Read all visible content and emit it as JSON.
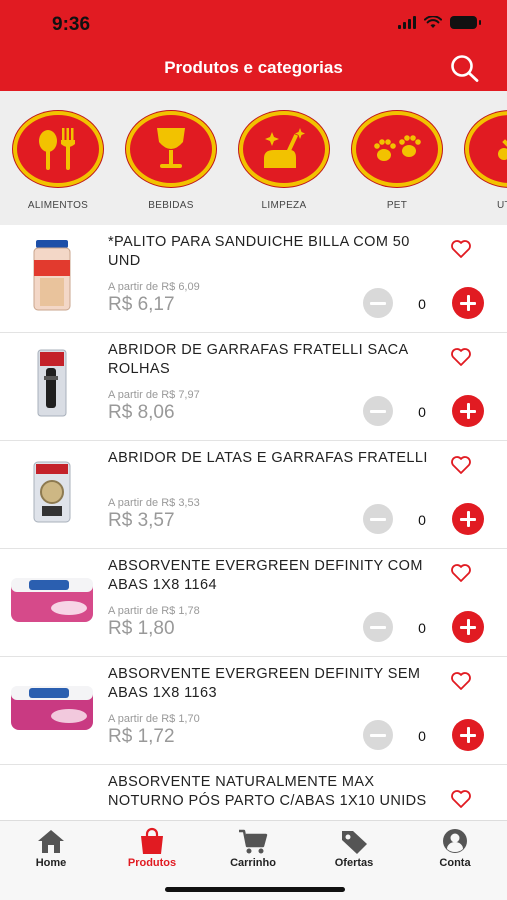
{
  "status_bar": {
    "time": "9:36"
  },
  "header": {
    "title": "Produtos e categorias",
    "search_icon": "search-icon"
  },
  "categories": [
    {
      "label": "ALIMENTOS",
      "icon": "cutlery-icon"
    },
    {
      "label": "BEBIDAS",
      "icon": "wine-glass-icon"
    },
    {
      "label": "LIMPEZA",
      "icon": "cleaning-icon"
    },
    {
      "label": "PET",
      "icon": "paw-icon"
    },
    {
      "label": "UTILI",
      "icon": "utensils-icon"
    }
  ],
  "products": [
    {
      "name": "*PALITO PARA SANDUICHE BILLA COM 50 UND",
      "from_price": "A partir de R$ 6,09",
      "price": "R$ 6,17",
      "quantity": "0"
    },
    {
      "name": "ABRIDOR DE GARRAFAS FRATELLI SACA ROLHAS",
      "from_price": "A partir de R$ 7,97",
      "price": "R$ 8,06",
      "quantity": "0"
    },
    {
      "name": "ABRIDOR DE LATAS E GARRAFAS FRATELLI",
      "from_price": "A partir de R$ 3,53",
      "price": "R$ 3,57",
      "quantity": "0"
    },
    {
      "name": "ABSORVENTE EVERGREEN DEFINITY COM ABAS 1X8 1164",
      "from_price": "A partir de R$ 1,78",
      "price": "R$ 1,80",
      "quantity": "0"
    },
    {
      "name": "ABSORVENTE EVERGREEN DEFINITY SEM ABAS 1X8 1163",
      "from_price": "A partir de R$ 1,70",
      "price": "R$ 1,72",
      "quantity": "0"
    },
    {
      "name": "ABSORVENTE NATURALMENTE  MAX NOTURNO PÓS PARTO C/ABAS 1X10 UNIDS"
    }
  ],
  "tabbar": {
    "active": "Produtos",
    "items": [
      {
        "label": "Home",
        "icon": "home-icon"
      },
      {
        "label": "Produtos",
        "icon": "bag-icon"
      },
      {
        "label": "Carrinho",
        "icon": "cart-icon"
      },
      {
        "label": "Ofertas",
        "icon": "tag-icon"
      },
      {
        "label": "Conta",
        "icon": "user-icon"
      }
    ]
  },
  "colors": {
    "brand_red": "#e11b22",
    "category_border": "#f2c200",
    "muted_text": "#999999"
  }
}
